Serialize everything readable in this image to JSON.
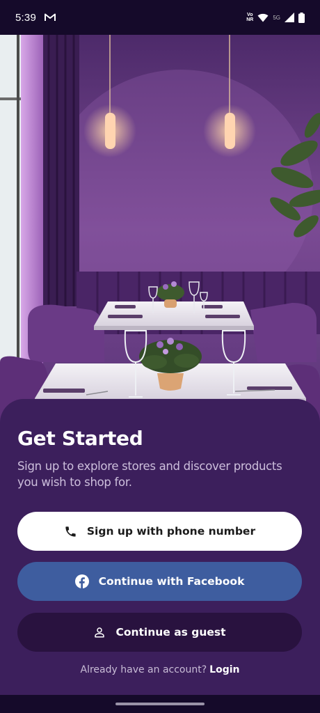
{
  "status_bar": {
    "time": "5:39",
    "volte_top": "Vo",
    "volte_bottom": "NR",
    "network": "5G"
  },
  "hero": {
    "image_icon": "restaurant-interior-photo"
  },
  "sheet": {
    "title": "Get Started",
    "subtitle": "Sign up to explore stores and discover products you wish to shop for."
  },
  "buttons": {
    "phone": {
      "label": "Sign up with phone number",
      "icon": "phone-icon"
    },
    "facebook": {
      "label": "Continue with Facebook",
      "icon": "facebook-icon"
    },
    "guest": {
      "label": "Continue as guest",
      "icon": "person-icon"
    }
  },
  "footer": {
    "prompt": "Already have an account?",
    "login": "Login"
  },
  "colors": {
    "sheet_bg": "#3c1f5c",
    "facebook_blue": "#3e5d9f",
    "guest_bg": "#29123f"
  }
}
